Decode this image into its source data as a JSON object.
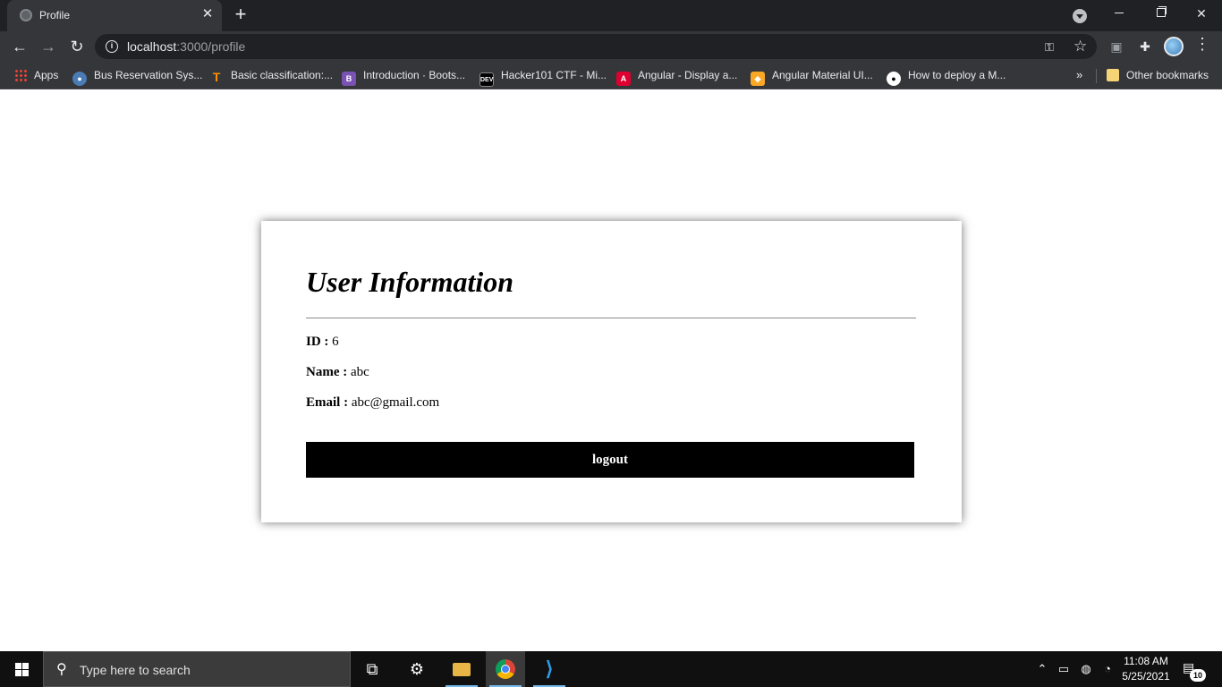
{
  "browser": {
    "tab_title": "Profile",
    "url_host": "localhost",
    "url_path": ":3000/profile",
    "bookmarks": [
      {
        "label": "Apps",
        "icon": "apps-grid-icon"
      },
      {
        "label": "Bus Reservation Sys...",
        "icon": "bus-icon"
      },
      {
        "label": "Basic classification:...",
        "icon": "tensorflow-icon"
      },
      {
        "label": "Introduction · Boots...",
        "icon": "bootstrap-icon"
      },
      {
        "label": "Hacker101 CTF - Mi...",
        "icon": "dev-icon"
      },
      {
        "label": "Angular - Display a...",
        "icon": "angular-icon"
      },
      {
        "label": "Angular Material UI...",
        "icon": "angular-material-icon"
      },
      {
        "label": "How to deploy a M...",
        "icon": "medium-icon"
      }
    ],
    "other_bookmarks": "Other bookmarks"
  },
  "profile": {
    "title": "User Information",
    "id_label": "ID :",
    "id_value": "6",
    "name_label": "Name :",
    "name_value": "abc",
    "email_label": "Email :",
    "email_value": "abc@gmail.com",
    "logout_label": "logout"
  },
  "taskbar": {
    "search_placeholder": "Type here to search",
    "time": "11:08 AM",
    "date": "5/25/2021",
    "notification_count": "10"
  },
  "colors": {
    "chrome_dark": "#202124",
    "toolbar": "#35363a",
    "button_bg": "#000000",
    "button_text": "#ffffff"
  }
}
